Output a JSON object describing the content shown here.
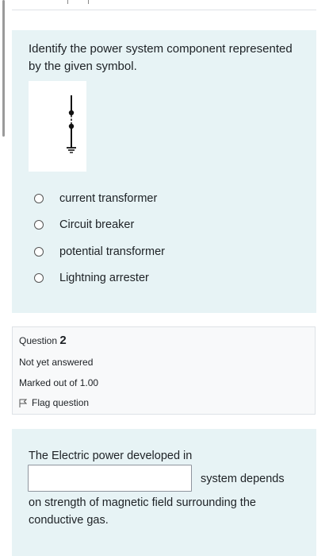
{
  "question1": {
    "prompt": "Identify the power system component represented by the given symbol.",
    "symbol": "lightning-arrester-symbol",
    "options": [
      {
        "label": "current transformer",
        "selected": false
      },
      {
        "label": "Circuit breaker",
        "selected": false
      },
      {
        "label": "potential transformer",
        "selected": false
      },
      {
        "label": "Lightning arrester",
        "selected": false
      }
    ]
  },
  "question2_info": {
    "title": "Question",
    "number": "2",
    "status": "Not yet answered",
    "marks": "Marked out of 1.00",
    "flag_label": "Flag question",
    "flag_icon": "flag-icon"
  },
  "question2": {
    "text_before": "The Electric power developed in",
    "answer_value": "",
    "text_after_input": "system depends",
    "text_line3": "on strength of magnetic field surrounding the",
    "text_line4": "conductive gas."
  },
  "colors": {
    "card_background": "#e7f3f5",
    "info_background": "#f8f9fa",
    "border": "#dee2e6"
  }
}
